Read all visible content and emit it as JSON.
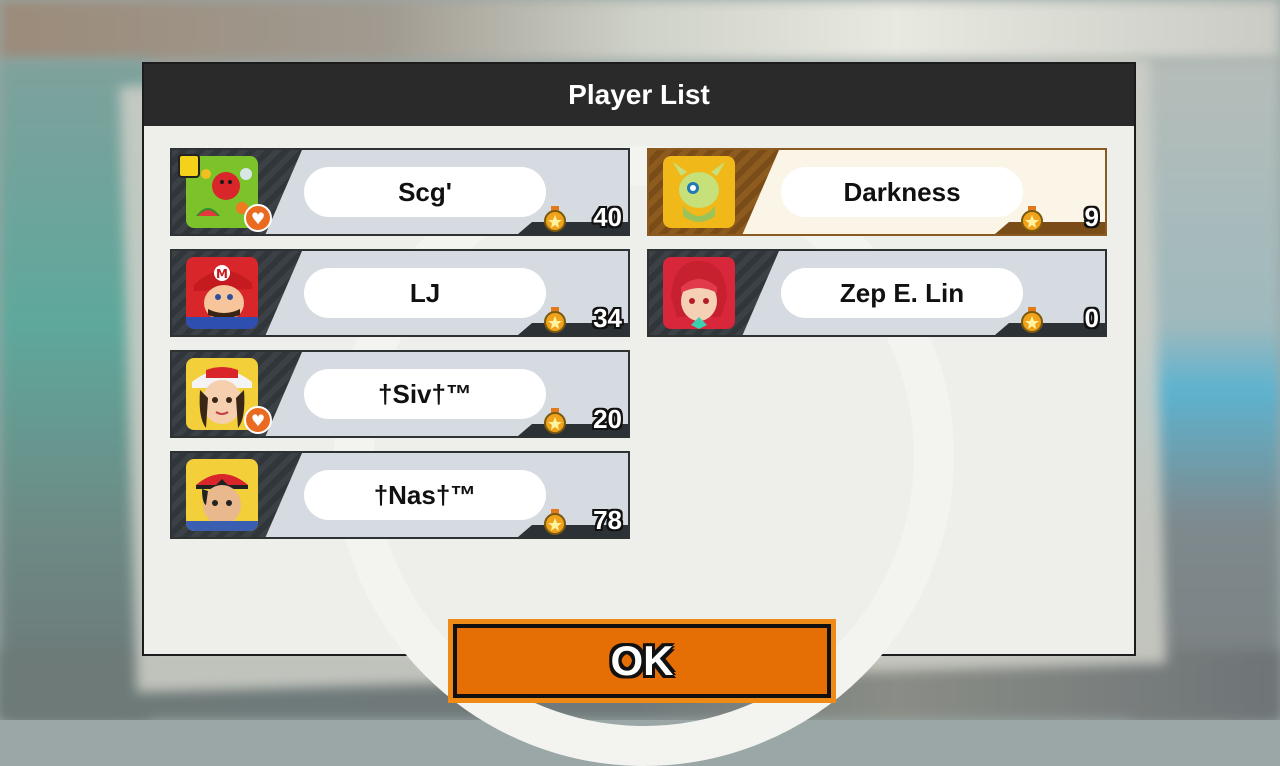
{
  "dialog": {
    "title": "Player List",
    "ok_label": "OK"
  },
  "players": [
    {
      "name": "Scg'",
      "score": "40",
      "character_icon": "pac-man-fruit-icon",
      "lock_badge": true,
      "heart_badge": true,
      "highlight": false
    },
    {
      "name": "LJ",
      "score": "34",
      "character_icon": "mario-icon",
      "lock_badge": false,
      "heart_badge": false,
      "highlight": false
    },
    {
      "name": "†Siv†™",
      "score": "20",
      "character_icon": "pokemon-trainer-female-icon",
      "lock_badge": false,
      "heart_badge": true,
      "highlight": false
    },
    {
      "name": "†Nas†™",
      "score": "78",
      "character_icon": "pokemon-trainer-male-icon",
      "lock_badge": false,
      "heart_badge": false,
      "highlight": false
    },
    {
      "name": "Darkness",
      "score": "9",
      "character_icon": "celebi-icon",
      "lock_badge": false,
      "heart_badge": false,
      "highlight": true
    },
    {
      "name": "Zep E. Lin",
      "score": "0",
      "character_icon": "pyra-icon",
      "lock_badge": false,
      "heart_badge": false,
      "highlight": false
    }
  ],
  "colors": {
    "header_bg": "#2a2a2a",
    "ok_orange": "#e56f05",
    "highlight_brown": "#8e5b1f",
    "card_bg": "#d5dbe0",
    "medal": "#f0a31a"
  }
}
